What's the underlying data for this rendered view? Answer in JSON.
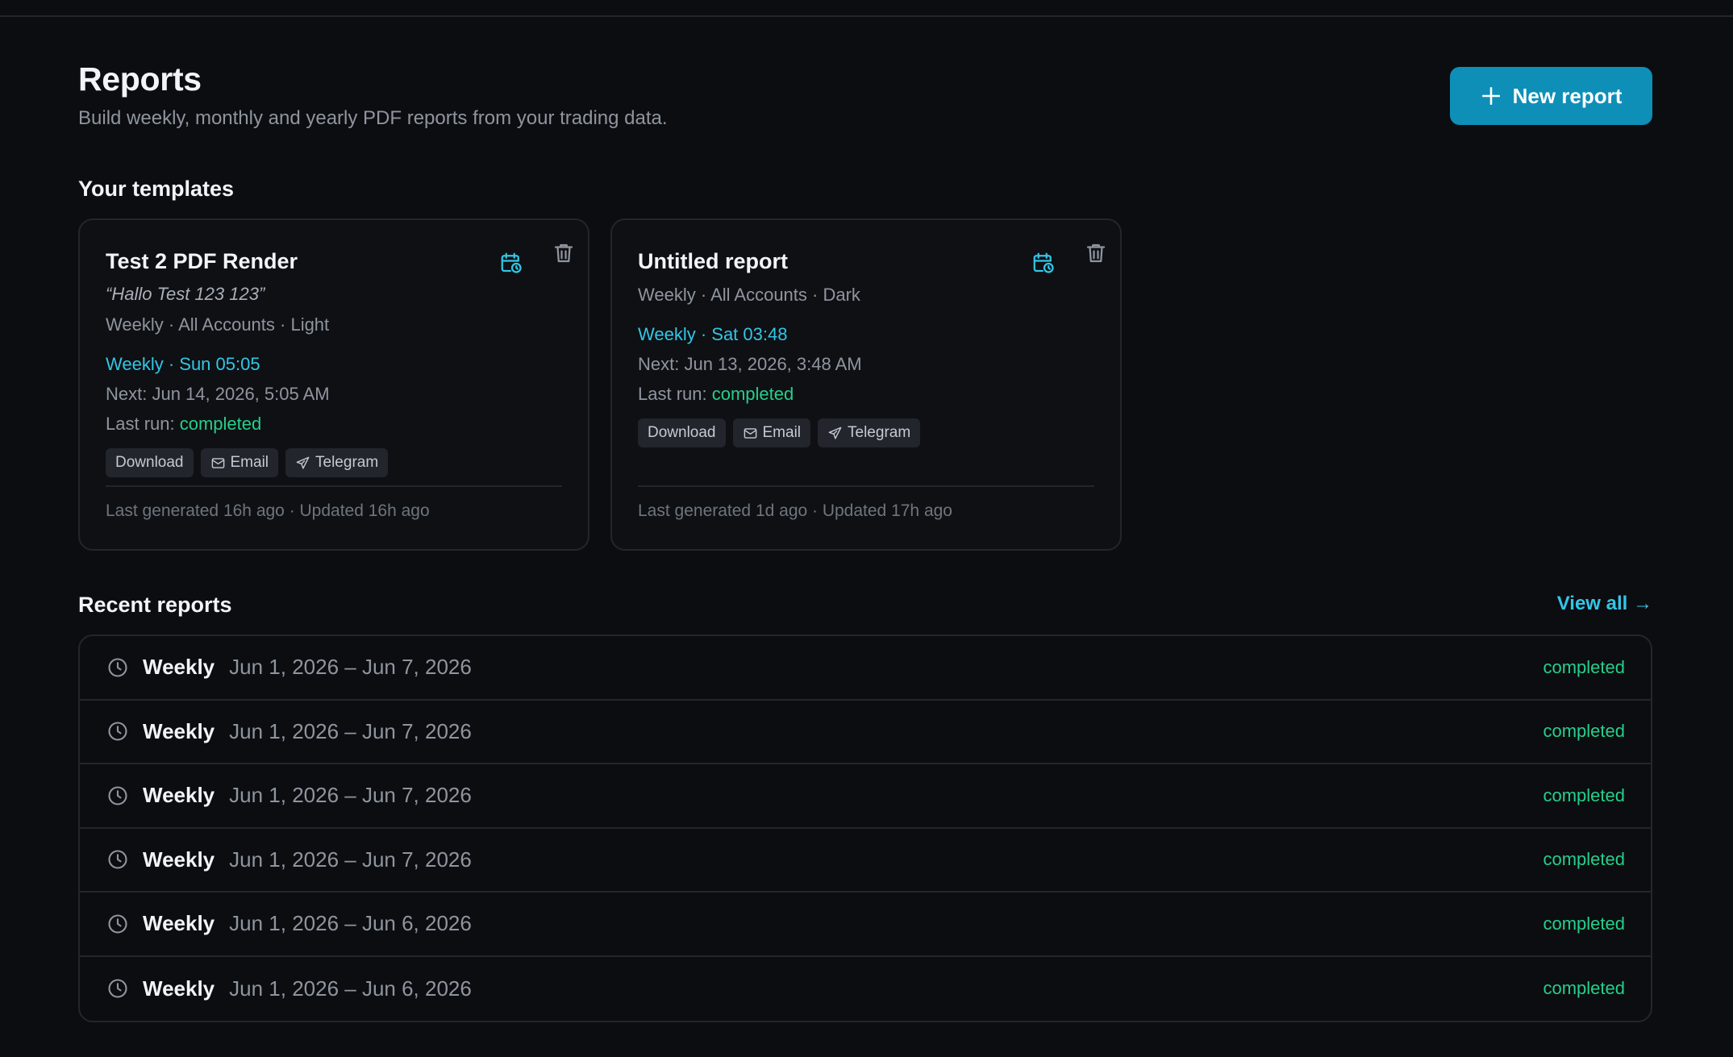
{
  "header": {
    "title": "Reports",
    "subtitle": "Build weekly, monthly and yearly PDF reports from your trading data.",
    "new_report_label": "New report"
  },
  "templates_section": {
    "title": "Your templates",
    "cards": [
      {
        "title": "Test 2 PDF Render",
        "description": "“Hallo Test 123 123”",
        "meta": "Weekly · All Accounts · Light",
        "schedule": "Weekly · Sun 05:05",
        "next_run": "Next: Jun 14, 2026, 5:05 AM",
        "last_run_label": "Last run:",
        "last_run_status": "completed",
        "delivery": {
          "download": "Download",
          "email": "Email",
          "telegram": "Telegram"
        },
        "footer": "Last generated 16h ago · Updated 16h ago"
      },
      {
        "title": "Untitled report",
        "meta": "Weekly · All Accounts · Dark",
        "schedule": "Weekly · Sat 03:48",
        "next_run": "Next: Jun 13, 2026, 3:48 AM",
        "last_run_label": "Last run:",
        "last_run_status": "completed",
        "delivery": {
          "download": "Download",
          "email": "Email",
          "telegram": "Telegram"
        },
        "footer": "Last generated 1d ago · Updated 17h ago"
      }
    ]
  },
  "recent_section": {
    "title": "Recent reports",
    "view_all_label": "View all →",
    "rows": [
      {
        "kind": "Weekly",
        "range": "Jun 1, 2026 – Jun 7, 2026",
        "status": "completed"
      },
      {
        "kind": "Weekly",
        "range": "Jun 1, 2026 – Jun 7, 2026",
        "status": "completed"
      },
      {
        "kind": "Weekly",
        "range": "Jun 1, 2026 – Jun 7, 2026",
        "status": "completed"
      },
      {
        "kind": "Weekly",
        "range": "Jun 1, 2026 – Jun 7, 2026",
        "status": "completed"
      },
      {
        "kind": "Weekly",
        "range": "Jun 1, 2026 – Jun 6, 2026",
        "status": "completed"
      },
      {
        "kind": "Weekly",
        "range": "Jun 1, 2026 – Jun 6, 2026",
        "status": "completed"
      }
    ]
  },
  "colors": {
    "background": "#0b0d11",
    "card_background": "#0e1014",
    "accent": "#0e8fb8",
    "link": "#33c6e6",
    "success": "#26cf8a",
    "muted_text": "#8f959e"
  },
  "icons": {
    "new_report": "plus-icon",
    "schedule": "calendar-clock-icon",
    "delete": "trash-icon",
    "email": "mail-icon",
    "telegram": "send-icon",
    "row": "clock-icon"
  }
}
